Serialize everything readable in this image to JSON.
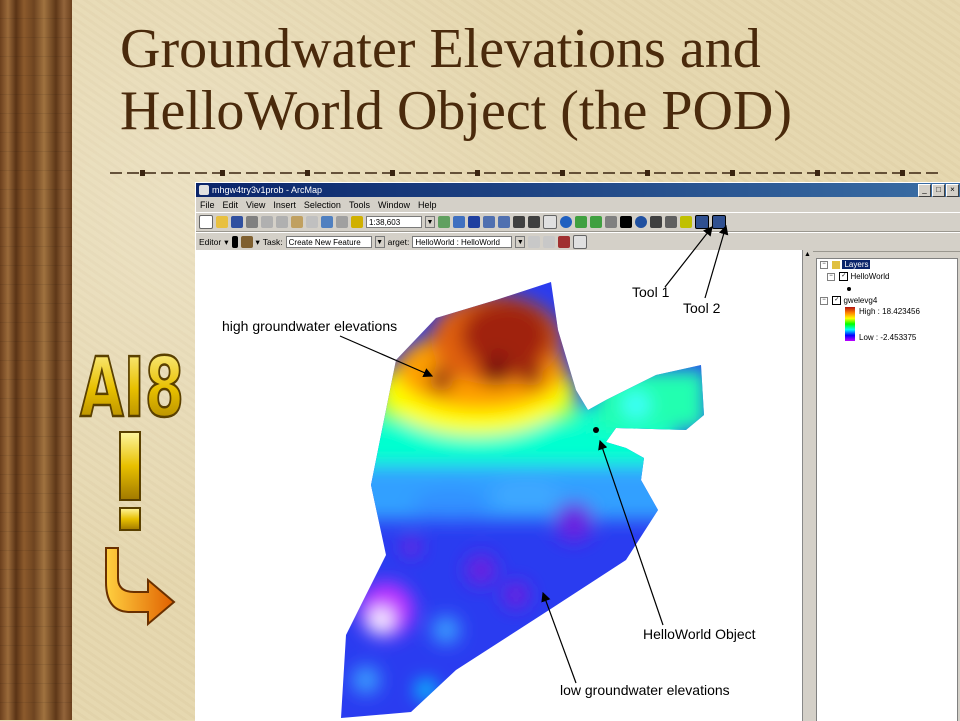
{
  "slide": {
    "title_line1": "Groundwater Elevations and",
    "title_line2": "HelloWorld Object (the POD)",
    "logo_text": "AI8"
  },
  "window": {
    "title": "mhgw4try3v1prob - ArcMap",
    "controls": [
      "_",
      "□",
      "×"
    ]
  },
  "menu": [
    "File",
    "Edit",
    "View",
    "Insert",
    "Selection",
    "Tools",
    "Window",
    "Help"
  ],
  "standard_toolbar": {
    "scale": "1:38,603"
  },
  "editor_toolbar": {
    "editor_label": "Editor",
    "task_label": "Task:",
    "task_value": "Create New Feature",
    "target_label": "arget:",
    "target_value": "HelloWorld : HelloWorld"
  },
  "toc": {
    "root": "Layers",
    "layers": [
      {
        "name": "HelloWorld",
        "checked": true
      },
      {
        "name": "gwelevg4",
        "checked": true
      }
    ],
    "legend_high": "High : 18.423456",
    "legend_low": "Low : -2.453375"
  },
  "annotations": {
    "high_elev": "high groundwater elevations",
    "tool1": "Tool 1",
    "tool2": "Tool 2",
    "helloworld_object": "HelloWorld Object",
    "low_elev": "low groundwater elevations"
  },
  "colors": {
    "title": "#4a2a0c",
    "accent_arrow": "#e07000",
    "win_title": "#0a246a"
  }
}
